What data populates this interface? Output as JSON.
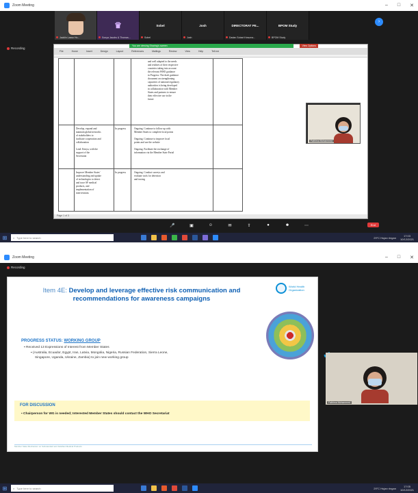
{
  "top": {
    "window_title": "Zoom Meeting",
    "participants": [
      {
        "name": "",
        "caption": "Jacklin Lasso Ho..."
      },
      {
        "name": "",
        "caption": "Sonya Jacobs & Thomas..."
      },
      {
        "name": "Sobel",
        "caption": "Sobel"
      },
      {
        "name": "Josh",
        "caption": "Josh"
      },
      {
        "name": "DIRECTORAT PE...",
        "caption": "Dadan Sobari Kesuma..."
      },
      {
        "name": "BPOM Study",
        "caption": "BPOM Study"
      }
    ],
    "recording_label": "Recording",
    "share_banner": "You are viewing Sharing's screen",
    "view_options": "View Options",
    "doc": {
      "ribbon_tabs": [
        "File",
        "Home",
        "Insert",
        "Design",
        "Layout",
        "References",
        "Mailings",
        "Review",
        "View",
        "Help",
        "Tell me"
      ],
      "status_text": "Page 1 of 3",
      "table_lines": [
        "and well adapted to the needs",
        "and realities of their respective",
        "countries taking into account",
        "the relevant WHO guidance",
        "in Progress: The draft guidance",
        "document on strengthening",
        "capacities of national regulatory",
        "authorities is being developed",
        "in collaboration with Member",
        "States and partners to ensure",
        "their effective use in the",
        "future"
      ],
      "row2": {
        "title_lines": [
          "Develop, expand and",
          "maintain global networks",
          "of stakeholders to",
          "facilitate cooperation and",
          "collaboration"
        ],
        "lead_lines": [
          "Lead: Kenya, with the",
          "support of the",
          "Secretariat"
        ],
        "status": "In progress",
        "items": [
          "Ongoing. Continue to follow up with",
          "Member States to complete focal points",
          "Ongoing. Continue to improve focal",
          "points and use the website",
          "Ongoing. Facilitate the exchange of",
          "information via the Member State Portal"
        ]
      },
      "row3": {
        "title_lines": [
          "Improve Member States'",
          "understanding and uptake",
          "of technologies to detect",
          "and trace SF medical",
          "products, and",
          "implementation of",
          "interventions"
        ],
        "status": "In progress",
        "items": [
          "Ongoing. Conduct surveys and",
          "evaluate tools for detection",
          "and tracing"
        ]
      }
    },
    "presenter_caption": "Fathima Mohammed",
    "toolbar": [
      "Unmute",
      "Start Video",
      "Participants",
      "Chat",
      "Share Screen",
      "Record",
      "Reactions",
      "More"
    ],
    "end_label": "End",
    "taskbar": {
      "search_placeholder": "Type here to search",
      "weather": "29°C Hujan ringan",
      "time": "17:03",
      "date": "10/12/2021"
    }
  },
  "bottom": {
    "window_title": "Zoom Meeting",
    "recording_label": "Recording",
    "slide": {
      "item_no": "Item 4E:",
      "title": "Develop and leverage effective risk communication and recommendations for awareness campaigns",
      "who_name": "World Health Organization",
      "progress_label": "PROGRESS STATUS:",
      "progress_value": "WORKING GROUP",
      "bullet_1": "Received 13 Expressions of Interest from Member States",
      "bullet_2": "(Australia, Ecuador, Egypt, Iran, Latvia, Mongolia, Nigeria, Russian Federation, Sierra Leone,",
      "bullet_3": "Singapore, Uganda, Ukraine, Zambia) to join new working group",
      "discussion_label": "FOR DISCUSSION",
      "discussion_text": "Chairperson for WG is needed; Interested Member States should contact the WHO Secretariat",
      "footer": "Member State Mechanism on Substandard and Falsified Medical Products"
    },
    "presenter_caption": "Fathima Mohammed",
    "taskbar": {
      "search_placeholder": "Type here to search",
      "weather": "29°C Hujan ringan",
      "time": "17:05",
      "date": "10/12/2021"
    }
  },
  "colors": {
    "zoom_blue": "#2d8cff",
    "share_green": "#29a84b",
    "who_blue": "#0d5fb3",
    "discussion_bg": "#fff8c8"
  }
}
